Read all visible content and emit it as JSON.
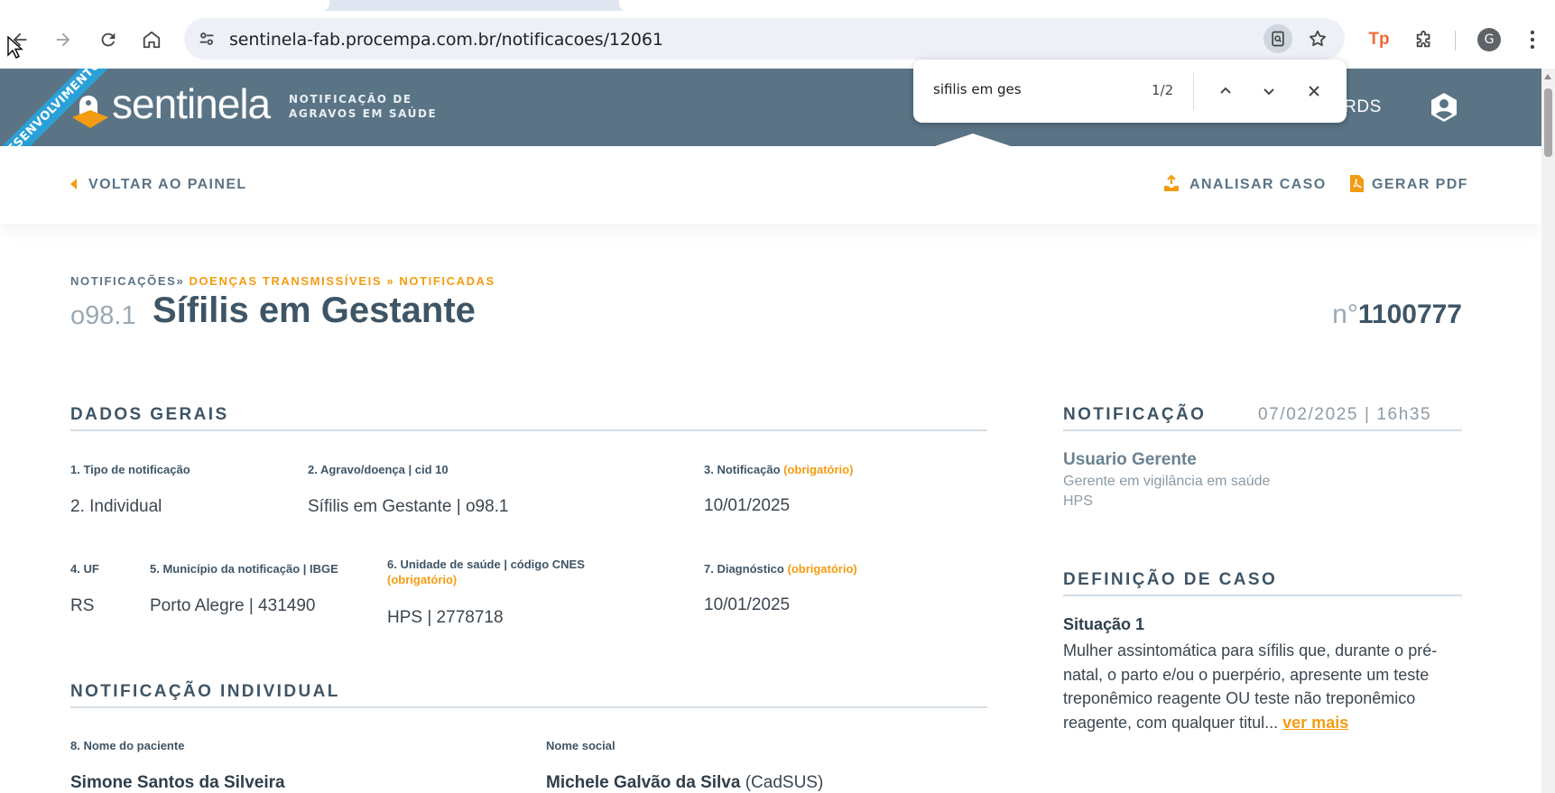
{
  "browser": {
    "url": "sentinela-fab.procempa.com.br/notificacoes/12061",
    "profile_initial": "G",
    "find": {
      "query": "sifilis em ges",
      "count": "1/2"
    }
  },
  "app": {
    "logo_text": "sentinela",
    "subtitle_line1": "NOTIFICAÇÃO DE",
    "subtitle_line2": "AGRAVOS EM SAÚDE",
    "env_ribbon": "DESENVOLVIMENTO",
    "nav_partial": "ARDS"
  },
  "actions": {
    "back": "VOLTAR AO PAINEL",
    "analyze": "ANALISAR CASO",
    "pdf": "GERAR PDF"
  },
  "breadcrumb": {
    "root": "NOTIFICAÇÕES»",
    "group": "DOENÇAS TRANSMISSÍVEIS",
    "sep": "»",
    "leaf": "NOTIFICADAS"
  },
  "header": {
    "cid": "o98.1",
    "title": "Sífilis em Gestante",
    "number_prefix": "n°",
    "number": "1100777"
  },
  "dados_gerais": {
    "title": "DADOS GERAIS",
    "f1_label": "1. Tipo de notificação",
    "f1_value": "2. Individual",
    "f2_label": "2. Agravo/doença | cid 10",
    "f2_value": "Sífilis em Gestante | o98.1",
    "f3_label": "3. Notificação",
    "f3_req": "(obrigatório)",
    "f3_value": "10/01/2025",
    "f4_label": "4. UF",
    "f4_value": "RS",
    "f5_label": "5. Município da notificação | IBGE",
    "f5_value": "Porto Alegre | 431490",
    "f6_label": "6. Unidade de saúde | código CNES",
    "f6_req": "(obrigatório)",
    "f6_value": "HPS | 2778718",
    "f7_label": "7. Diagnóstico",
    "f7_req": "(obrigatório)",
    "f7_value": "10/01/2025"
  },
  "notificacao_individual": {
    "title": "NOTIFICAÇÃO INDIVIDUAL",
    "f8_label": "8. Nome do paciente",
    "f8_value": "Simone Santos da Silveira",
    "social_label": "Nome social",
    "social_value": "Michele Galvão da Silva",
    "social_source": "(CadSUS)"
  },
  "notificacao_panel": {
    "title": "NOTIFICAÇÃO",
    "date": "07/02/2025 | 16h35",
    "user_name": "Usuario Gerente",
    "user_role": "Gerente em vigilância em saúde",
    "user_unit": "HPS"
  },
  "definicao": {
    "title": "DEFINIÇÃO DE CASO",
    "situation": "Situação 1",
    "text": "Mulher assintomática para sífilis que, durante o pré-natal, o parto e/ou o puerpério, apresente um teste treponêmico reagente OU teste não treponêmico reagente, com qualquer titul...",
    "more": "ver mais"
  },
  "colors": {
    "header_bg": "#5a7486",
    "accent": "#f39c12",
    "ribbon": "#2aa0d8",
    "heading": "#3e5566"
  }
}
